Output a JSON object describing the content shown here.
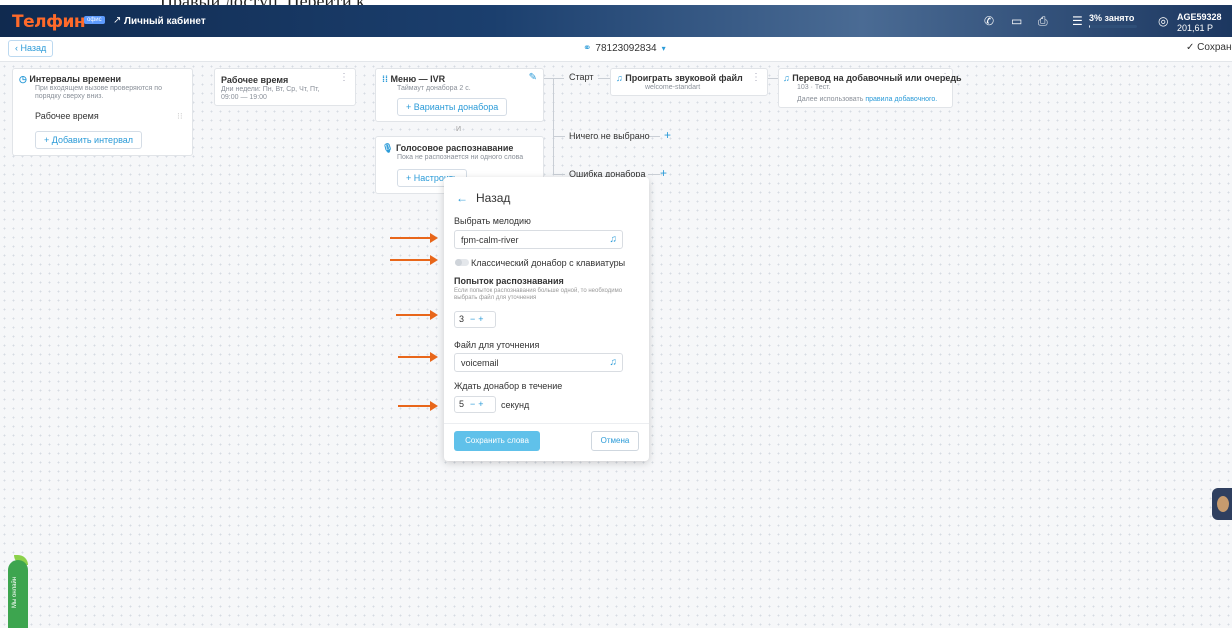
{
  "top_caption": "Правый доступ. Перейти к",
  "header": {
    "logo": "Телфин",
    "logo_badge": "офис",
    "cabinet_label": "Личный кабинет",
    "storage_label": "3% занято",
    "storage_fraction": 0.03,
    "account_id": "AGE59328",
    "balance": "201,61 Р",
    "icons": [
      "phone-icon",
      "chat-icon",
      "print-icon",
      "database-icon",
      "user-icon"
    ]
  },
  "subbar": {
    "back_label": "Назад",
    "phone_number": "78123092834",
    "save_label": "Сохране"
  },
  "nodes": {
    "intervals": {
      "title": "Интервалы времени",
      "desc": "При входящем вызове проверяются по порядку сверху вниз.",
      "item": "Рабочее время",
      "add_button": "Добавить интервал"
    },
    "worktime": {
      "title": "Рабочее время",
      "desc": "Дни недели: Пн, Вт, Ср, Чт, Пт,",
      "hours": "09:00 — 19:00"
    },
    "ivr": {
      "title": "Меню — IVR",
      "desc": "Таймаут донабора 2 с.",
      "button": "Варианты донабора",
      "or_label": "И"
    },
    "voice": {
      "title": "Голосовое распознавание",
      "desc": "Пока не распознается ни одного слова",
      "button": "Настроить"
    },
    "start_label": "Старт",
    "play": {
      "title": "Проиграть звуковой файл",
      "desc": "welcome-standart"
    },
    "transfer": {
      "title": "Перевод на добавочный или очередь",
      "desc": "103 · Тест.",
      "footer_prefix": "Далее использовать",
      "footer_link": "правила добавочного."
    },
    "nothing_label": "Ничего не выбрано",
    "error_label": "Ошибка донабора"
  },
  "panel": {
    "back_label": "Назад",
    "melody_label": "Выбрать мелодию",
    "melody_value": "fpm-calm-river",
    "toggle_label": "Классический донабор с клавиатуры",
    "toggle_on": false,
    "attempts_label": "Попыток распознавания",
    "attempts_hint": "Если попыток распознавания больше одной, то необходимо выбрать файл для уточнения",
    "attempts_value": "3",
    "clarify_label": "Файл для уточнения",
    "clarify_value": "voicemail",
    "wait_label": "Ждать донабор в течение",
    "wait_value": "5",
    "wait_unit": "секунд",
    "save_button": "Сохранить слова",
    "cancel_button": "Отмена"
  },
  "online_tab": "Мы онлайн",
  "colors": {
    "accent": "#2b9bd8",
    "brand_orange": "#ff6a2a",
    "arrow": "#e8661a",
    "online_green": "#3da54f"
  }
}
